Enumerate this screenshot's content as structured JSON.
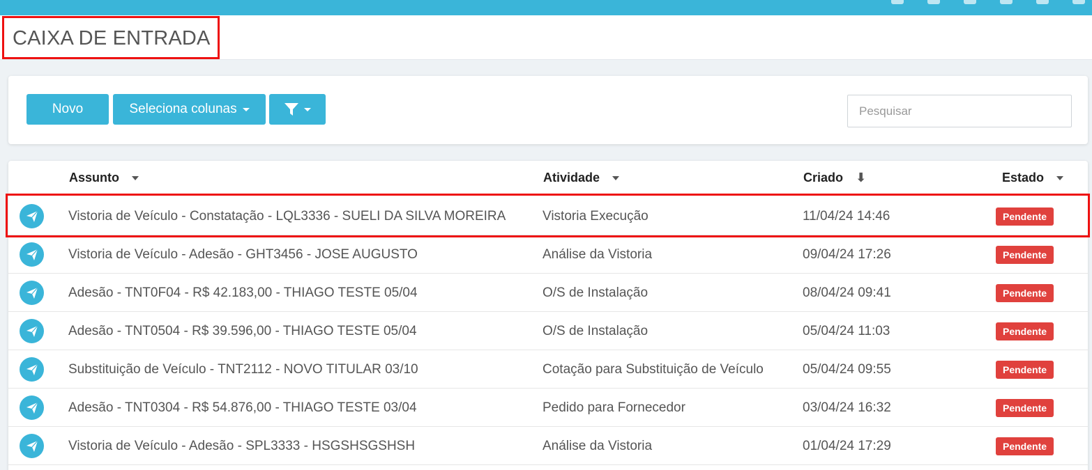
{
  "header": {
    "title": "CAIXA DE ENTRADA"
  },
  "toolbar": {
    "new_label": "Novo",
    "columns_label": "Seleciona colunas",
    "filter_icon": "filter-icon",
    "search_placeholder": "Pesquisar"
  },
  "table": {
    "columns": [
      "Assunto",
      "Atividade",
      "Criado",
      "Estado"
    ],
    "rows": [
      {
        "assunto": "Vistoria de Veículo - Constatação - LQL3336 - SUELI DA SILVA MOREIRA",
        "atividade": "Vistoria Execução",
        "criado": "11/04/24 14:46",
        "estado": "Pendente"
      },
      {
        "assunto": "Vistoria de Veículo - Adesão - GHT3456 - JOSE AUGUSTO",
        "atividade": "Análise da Vistoria",
        "criado": "09/04/24 17:26",
        "estado": "Pendente"
      },
      {
        "assunto": "Adesão - TNT0F04 - R$ 42.183,00 - THIAGO TESTE 05/04",
        "atividade": "O/S de Instalação",
        "criado": "08/04/24 09:41",
        "estado": "Pendente"
      },
      {
        "assunto": "Adesão - TNT0504 - R$ 39.596,00 - THIAGO TESTE 05/04",
        "atividade": "O/S de Instalação",
        "criado": "05/04/24 11:03",
        "estado": "Pendente"
      },
      {
        "assunto": "Substituição de Veículo - TNT2112 - NOVO TITULAR 03/10",
        "atividade": "Cotação para Substituição de Veículo",
        "criado": "05/04/24 09:55",
        "estado": "Pendente"
      },
      {
        "assunto": "Adesão - TNT0304 - R$ 54.876,00 - THIAGO TESTE 03/04",
        "atividade": "Pedido para Fornecedor",
        "criado": "03/04/24 16:32",
        "estado": "Pendente"
      },
      {
        "assunto": "Vistoria de Veículo - Adesão - SPL3333 - HSGSHSGSHSH",
        "atividade": "Análise da Vistoria",
        "criado": "01/04/24 17:29",
        "estado": "Pendente"
      }
    ]
  },
  "colors": {
    "accent": "#3ab5d9",
    "status_pending": "#e0413d",
    "highlight": "#ee1111"
  }
}
